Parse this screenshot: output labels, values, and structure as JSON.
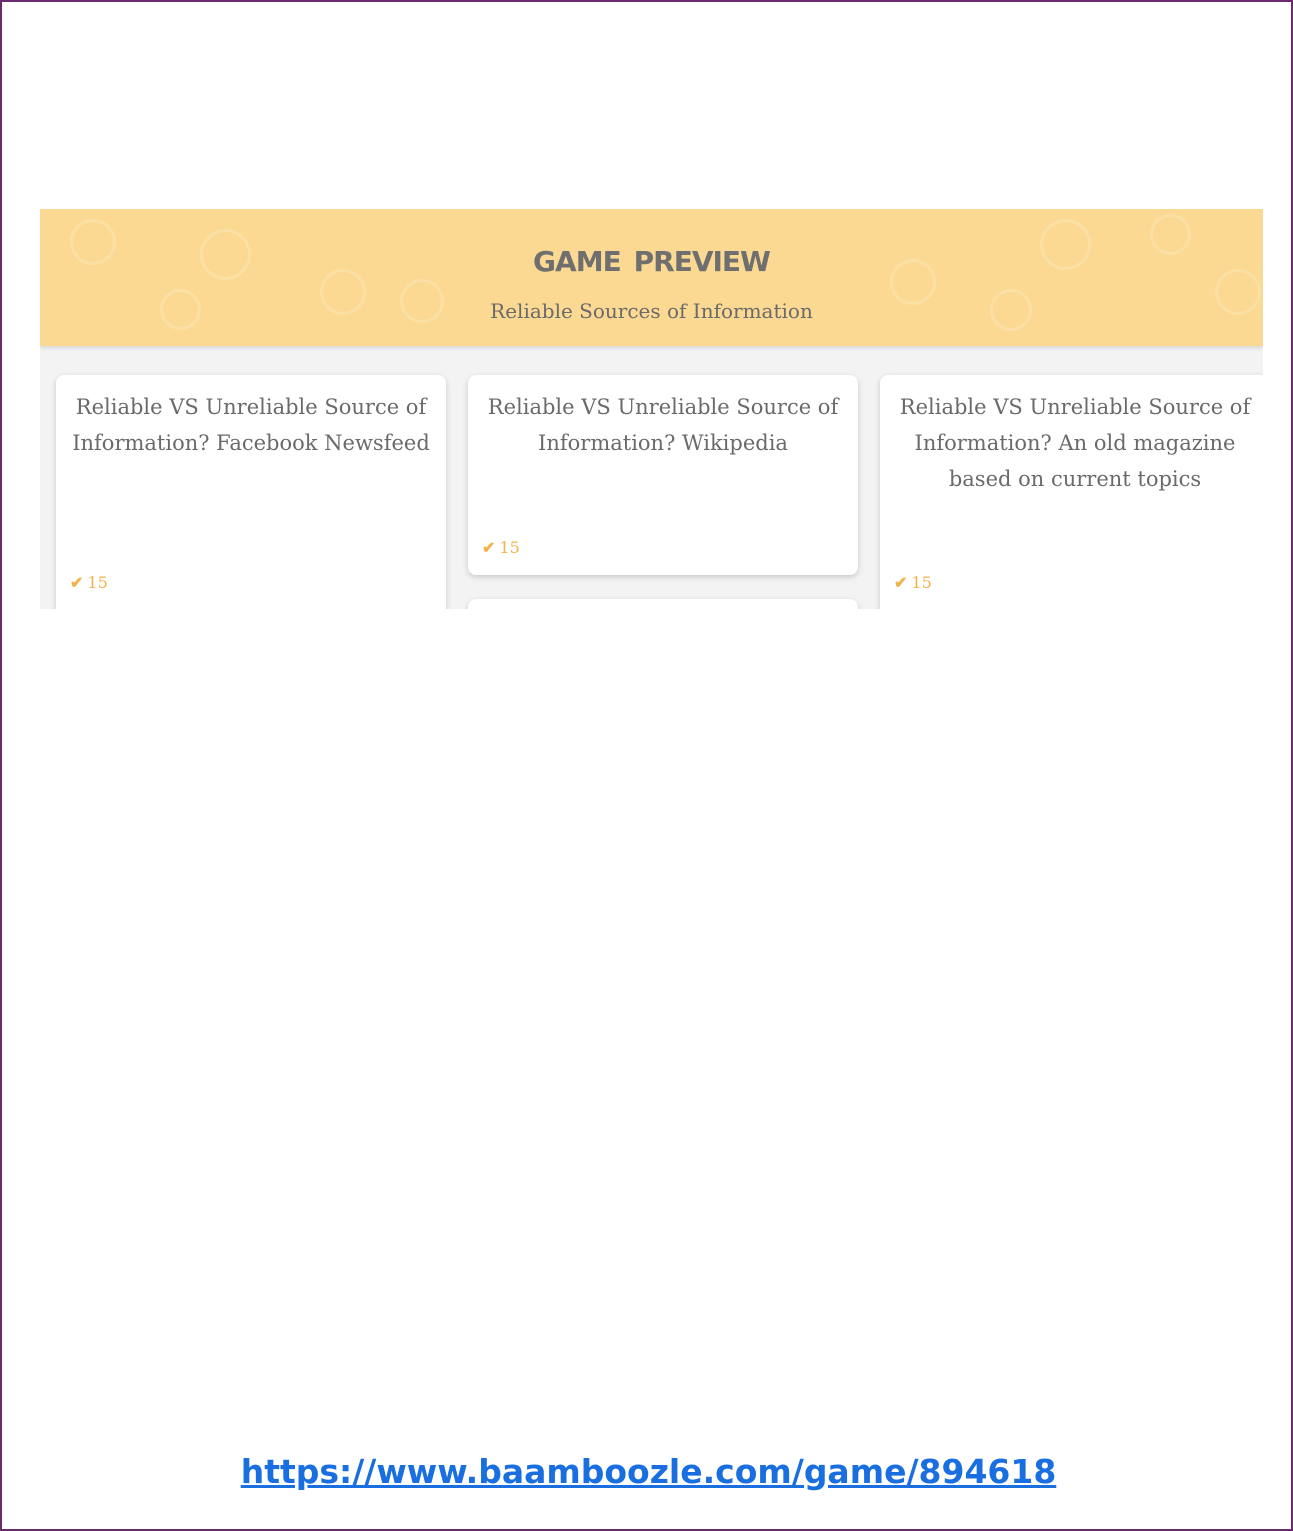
{
  "preview": {
    "title": "Game Preview",
    "subtitle": "Reliable Sources of Information",
    "header_color": "#fbd993",
    "accent_color": "#f3b24a"
  },
  "cards": [
    {
      "question": "Reliable VS Unreliable Source of Information? Facebook Newsfeed",
      "points": "15"
    },
    {
      "question": "Reliable VS Unreliable Source of Information? Wikipedia",
      "points": "15"
    },
    {
      "question": "Reliable VS Unreliable Source of Information? An old magazine based on current topics",
      "points": "15"
    }
  ],
  "footer": {
    "link_text": "https://www.baamboozle.com/game/894618",
    "link_color": "#1a6fe0"
  }
}
